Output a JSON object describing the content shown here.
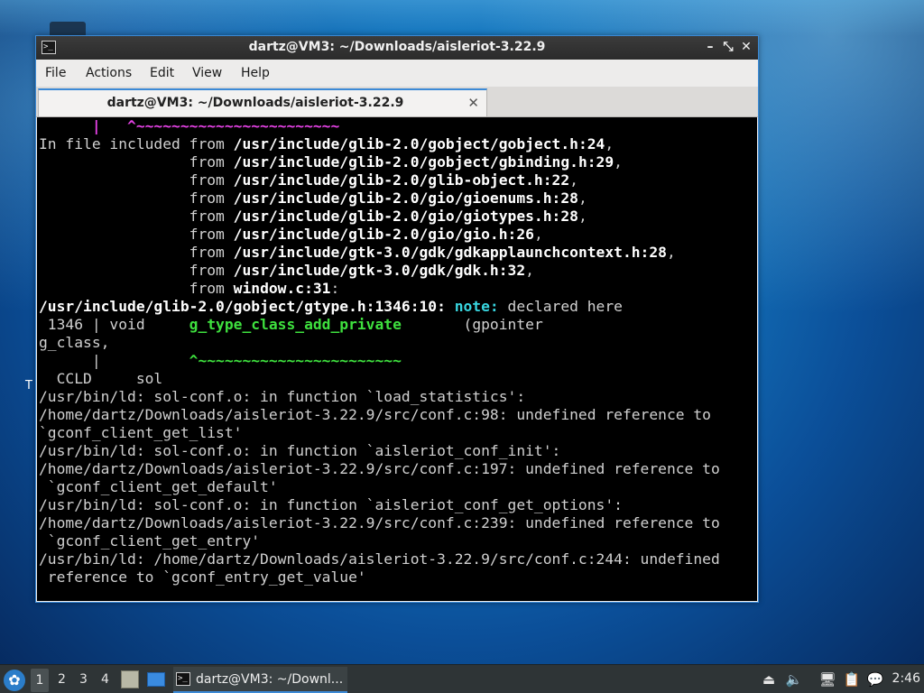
{
  "window": {
    "title": "dartz@VM3: ~/Downloads/aisleriot-3.22.9",
    "controls": {
      "minimize": "–",
      "maximize": "⤡",
      "close": "✕"
    }
  },
  "menubar": {
    "file": "File",
    "actions": "Actions",
    "edit": "Edit",
    "view": "View",
    "help": "Help"
  },
  "tab": {
    "label": "dartz@VM3: ~/Downloads/aisleriot-3.22.9",
    "close": "✕"
  },
  "terminal": {
    "l01": "      |   ^~~~~~~~~~~~~~~~~~~~~~~~",
    "l02a": "In file included from ",
    "l02b": "/usr/include/glib-2.0/gobject/gobject.h:24",
    "l02c": ",",
    "l03a": "                 from ",
    "l03b": "/usr/include/glib-2.0/gobject/gbinding.h:29",
    "l03c": ",",
    "l04a": "                 from ",
    "l04b": "/usr/include/glib-2.0/glib-object.h:22",
    "l04c": ",",
    "l05a": "                 from ",
    "l05b": "/usr/include/glib-2.0/gio/gioenums.h:28",
    "l05c": ",",
    "l06a": "                 from ",
    "l06b": "/usr/include/glib-2.0/gio/giotypes.h:28",
    "l06c": ",",
    "l07a": "                 from ",
    "l07b": "/usr/include/glib-2.0/gio/gio.h:26",
    "l07c": ",",
    "l08a": "                 from ",
    "l08b": "/usr/include/gtk-3.0/gdk/gdkapplaunchcontext.h:28",
    "l08c": ",",
    "l09a": "                 from ",
    "l09b": "/usr/include/gtk-3.0/gdk/gdk.h:32",
    "l09c": ",",
    "l10a": "                 from ",
    "l10b": "window.c:31",
    "l10c": ":",
    "l11a": "/usr/include/glib-2.0/gobject/gtype.h:1346:10: ",
    "l11b": "note:",
    "l11c": " declared here",
    "l12a": " 1346 | void     ",
    "l12b": "g_type_class_add_private",
    "l12c": "       (gpointer",
    "l13": "g_class,",
    "l14a": "      |          ",
    "l14b": "^~~~~~~~~~~~~~~~~~~~~~~~",
    "l15": "  CCLD     sol",
    "l16": "/usr/bin/ld: sol-conf.o: in function `load_statistics':",
    "l17": "/home/dartz/Downloads/aisleriot-3.22.9/src/conf.c:98: undefined reference to",
    "l18": "`gconf_client_get_list'",
    "l19": "/usr/bin/ld: sol-conf.o: in function `aisleriot_conf_init':",
    "l20": "/home/dartz/Downloads/aisleriot-3.22.9/src/conf.c:197: undefined reference to",
    "l21": " `gconf_client_get_default'",
    "l22": "/usr/bin/ld: sol-conf.o: in function `aisleriot_conf_get_options':",
    "l23": "/home/dartz/Downloads/aisleriot-3.22.9/src/conf.c:239: undefined reference to",
    "l24": " `gconf_client_get_entry'",
    "l25": "/usr/bin/ld: /home/dartz/Downloads/aisleriot-3.22.9/src/conf.c:244: undefined",
    "l26": " reference to `gconf_entry_get_value'"
  },
  "desktop": {
    "stray_letter": "T"
  },
  "taskbar": {
    "workspaces": [
      "1",
      "2",
      "3",
      "4"
    ],
    "task_label": "dartz@VM3: ~/Downl...",
    "clock": "2:46",
    "icons": [
      "start-menu-icon",
      "file-manager-icon",
      "show-desktop-icon",
      "terminal-icon",
      "eject-icon",
      "volume-icon",
      "network-icon",
      "clipboard-icon",
      "notification-icon"
    ]
  },
  "colors": {
    "accent": "#3c8ad6",
    "terminal_bg": "#000000",
    "note_cyan": "#38d6e0",
    "caret_magenta": "#e542e5",
    "caret_green": "#3ee03e"
  }
}
